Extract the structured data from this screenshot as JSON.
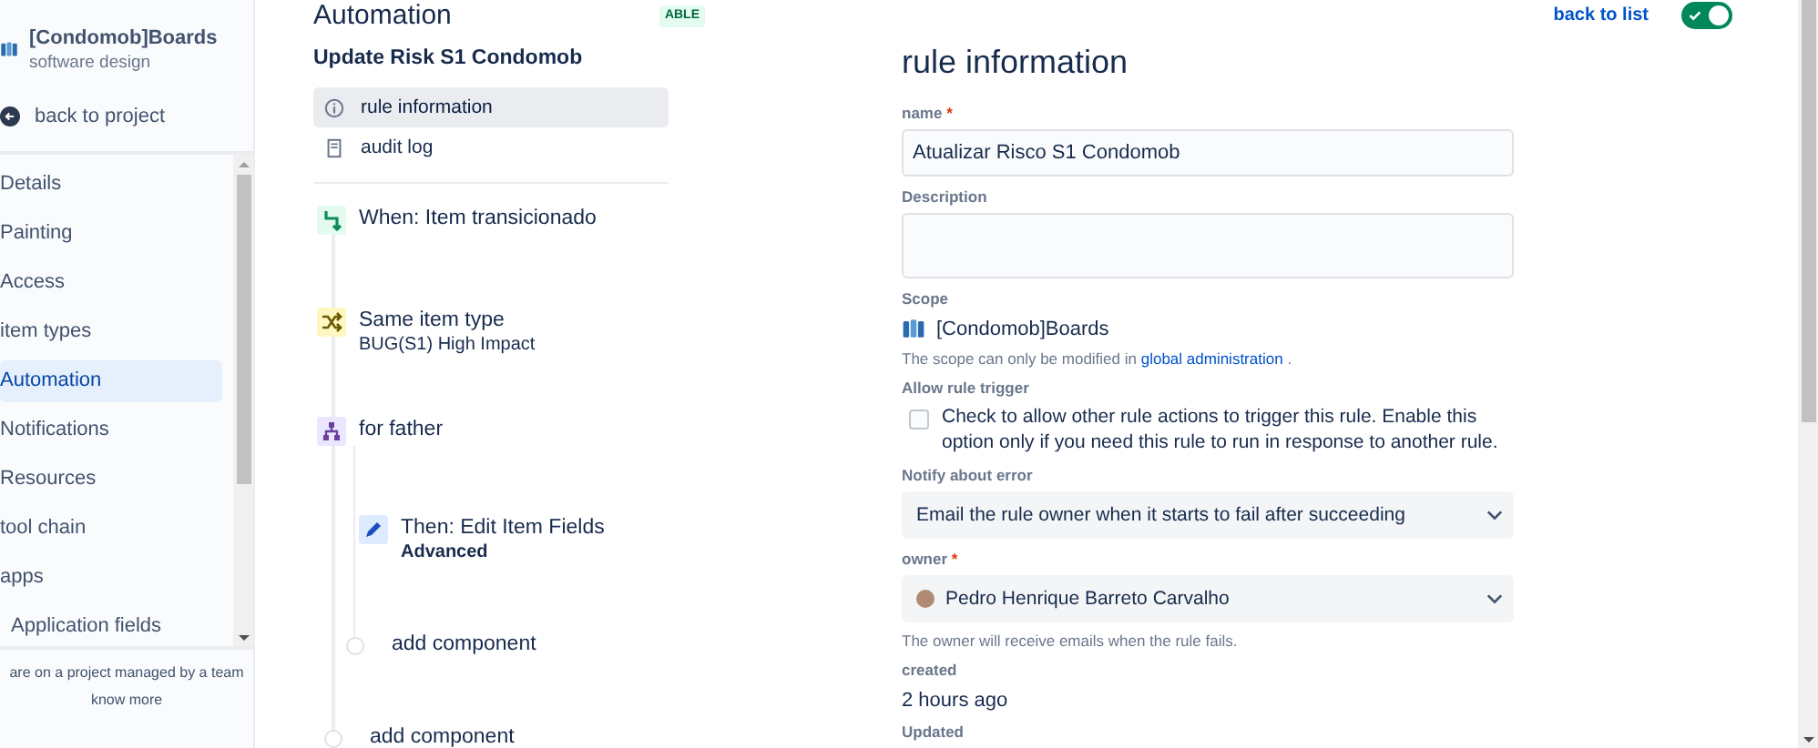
{
  "sidebar": {
    "project": {
      "name": "[Condomob]Boards",
      "subtitle": "software design"
    },
    "back_link": "back to project",
    "items": [
      {
        "label": "Details",
        "selected": false
      },
      {
        "label": "Painting",
        "selected": false
      },
      {
        "label": "Access",
        "selected": false
      },
      {
        "label": "item types",
        "selected": false
      },
      {
        "label": "Automation",
        "selected": true
      },
      {
        "label": "Notifications",
        "selected": false
      },
      {
        "label": "Resources",
        "selected": false
      },
      {
        "label": "tool chain",
        "selected": false
      },
      {
        "label": "apps",
        "selected": false
      },
      {
        "label": "Application fields",
        "selected": false,
        "sub": true
      }
    ],
    "footer": {
      "text": "are on a project managed by a team",
      "link": "know more"
    }
  },
  "header": {
    "title": "Automation",
    "badge": "ABLE",
    "back_link": "back to list",
    "enabled": {
      "on": true
    }
  },
  "rule": {
    "title": "Update Risk S1 Condomob",
    "menu": [
      {
        "label": "rule information",
        "kind": "info",
        "selected": true
      },
      {
        "label": "audit log",
        "kind": "log",
        "selected": false
      }
    ],
    "flow": [
      {
        "kind": "trigger",
        "label": "When: Item transicionado"
      },
      {
        "kind": "condition",
        "label": "Same item type",
        "detail": "BUG(S1) High Impact"
      },
      {
        "kind": "branch",
        "label": "for father",
        "children": [
          {
            "kind": "action",
            "label": "Then: Edit Item Fields",
            "detail": "Advanced"
          },
          {
            "kind": "add",
            "label": "add component"
          }
        ]
      },
      {
        "kind": "add",
        "label": "add component"
      }
    ]
  },
  "form": {
    "heading": "rule information",
    "name": {
      "label": "name",
      "required_mark": "*",
      "value": "Atualizar Risco S1 Condomob"
    },
    "description": {
      "label": "Description"
    },
    "scope": {
      "label": "Scope",
      "value": "[Condomob]Boards",
      "note": "The scope can only be modified in",
      "note_link": "global administration",
      "note_end": "."
    },
    "allow_trigger": {
      "label": "Allow rule trigger",
      "checked": false,
      "text": "Check to allow other rule actions to trigger this rule. Enable this option only if you need this rule to run in response to another rule."
    },
    "notify": {
      "label": "Notify about error",
      "value": "Email the rule owner when it starts to fail after succeeding"
    },
    "owner": {
      "label": "owner",
      "required_mark": "*",
      "value": "Pedro Henrique Barreto Carvalho",
      "hint": "The owner will receive emails when the rule fails."
    },
    "created": {
      "label": "created",
      "value": "2 hours ago"
    },
    "updated": {
      "label": "Updated"
    }
  }
}
